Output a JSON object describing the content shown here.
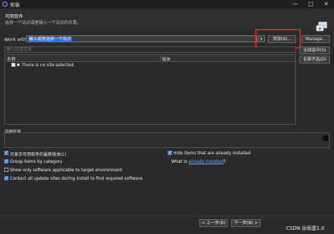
{
  "window": {
    "title": "安装",
    "controls": [
      "—",
      "□",
      "✕"
    ]
  },
  "header": {
    "title": "可用软件",
    "subtitle": "选择一个站点或者输入一个站点的位置。"
  },
  "work_with": {
    "label": "Work with:",
    "value": "输入或者选择一个站点",
    "add_button": "添加(A)...",
    "manage_button": "Manage..."
  },
  "filter": {
    "placeholder": "键入过滤文本"
  },
  "side_buttons": {
    "select_all": "全部选中(S)",
    "deselect_all": "全部不选(D)"
  },
  "table": {
    "columns": [
      "名称",
      "版本"
    ],
    "rows": [
      {
        "name": "There is no site selected."
      }
    ]
  },
  "details": {
    "label": "详细信息"
  },
  "options": {
    "show_latest": "只显示可用软件的最新版本(L)",
    "group_by_category": "Group items by category",
    "show_applicable": "Show only software applicable to target environment",
    "contact_all": "Contact all update sites during install to find required software",
    "hide_installed": "Hide items that are already installed",
    "what_is_prefix": "What is",
    "what_is_link": "already installed",
    "what_is_suffix": "?"
  },
  "footer": {
    "back_button": "< 上一步(B)",
    "next_button": "下一步(N) >"
  },
  "watermark": "CSDN @雨蛋1.0"
}
